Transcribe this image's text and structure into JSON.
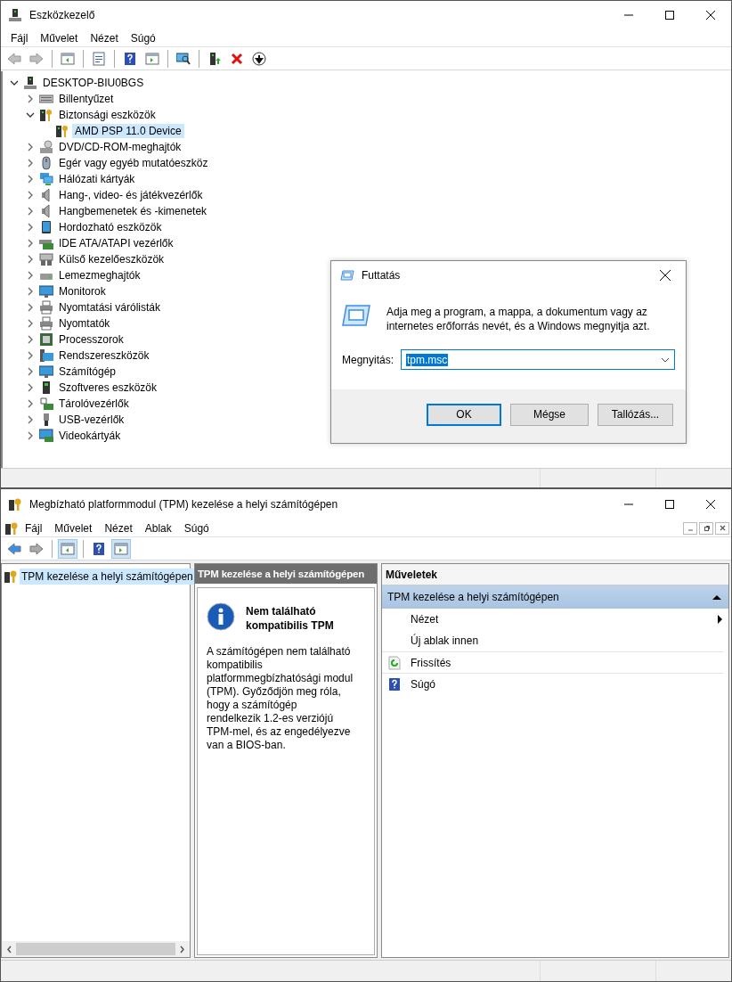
{
  "device_manager": {
    "title": "Eszközkezelő",
    "menu": [
      "Fájl",
      "Művelet",
      "Nézet",
      "Súgó"
    ],
    "toolbar": [
      {
        "kind": "back",
        "disabled": true
      },
      {
        "kind": "forward",
        "disabled": true
      },
      {
        "kind": "sep"
      },
      {
        "kind": "tree"
      },
      {
        "kind": "sep"
      },
      {
        "kind": "props"
      },
      {
        "kind": "sep"
      },
      {
        "kind": "help"
      },
      {
        "kind": "action"
      },
      {
        "kind": "sep"
      },
      {
        "kind": "scan"
      },
      {
        "kind": "sep"
      },
      {
        "kind": "update"
      },
      {
        "kind": "remove"
      },
      {
        "kind": "disable"
      }
    ],
    "tree": {
      "label": "DESKTOP-BIU0BGS",
      "kind": "computer-root",
      "expanded": true,
      "selected": false,
      "children": [
        {
          "label": "Billentyűzet",
          "kind": "keyboard",
          "expanded": false,
          "selected": false
        },
        {
          "label": "Biztonsági eszközök",
          "kind": "security",
          "expanded": true,
          "selected": false,
          "children": [
            {
              "label": "AMD PSP 11.0 Device",
              "kind": "security",
              "selected": true
            }
          ]
        },
        {
          "label": "DVD/CD-ROM-meghajtók",
          "kind": "dvd",
          "expanded": false,
          "selected": false
        },
        {
          "label": "Egér vagy egyéb mutatóeszköz",
          "kind": "mouse",
          "expanded": false,
          "selected": false
        },
        {
          "label": "Hálózati kártyák",
          "kind": "network",
          "expanded": false,
          "selected": false
        },
        {
          "label": "Hang-, video- és játékvezérlők",
          "kind": "sound",
          "expanded": false,
          "selected": false
        },
        {
          "label": "Hangbemenetek és -kimenetek",
          "kind": "sound",
          "expanded": false,
          "selected": false
        },
        {
          "label": "Hordozható eszközök",
          "kind": "portable",
          "expanded": false,
          "selected": false
        },
        {
          "label": "IDE ATA/ATAPI vezérlők",
          "kind": "controller",
          "expanded": false,
          "selected": false
        },
        {
          "label": "Külső kezelőeszközök",
          "kind": "hid",
          "expanded": false,
          "selected": false
        },
        {
          "label": "Lemezmeghajtók",
          "kind": "disk",
          "expanded": false,
          "selected": false
        },
        {
          "label": "Monitorok",
          "kind": "monitor",
          "expanded": false,
          "selected": false
        },
        {
          "label": "Nyomtatási várólisták",
          "kind": "printer",
          "expanded": false,
          "selected": false
        },
        {
          "label": "Nyomtatók",
          "kind": "printer",
          "expanded": false,
          "selected": false
        },
        {
          "label": "Processzorok",
          "kind": "cpu",
          "expanded": false,
          "selected": false
        },
        {
          "label": "Rendszereszközök",
          "kind": "system",
          "expanded": false,
          "selected": false
        },
        {
          "label": "Számítógép",
          "kind": "monitor",
          "expanded": false,
          "selected": false
        },
        {
          "label": "Szoftveres eszközök",
          "kind": "software",
          "expanded": false,
          "selected": false
        },
        {
          "label": "Tárolóvezérlők",
          "kind": "storage",
          "expanded": false,
          "selected": false
        },
        {
          "label": "USB-vezérlők",
          "kind": "usb",
          "expanded": false,
          "selected": false
        },
        {
          "label": "Videokártyák",
          "kind": "display",
          "expanded": false,
          "selected": false
        }
      ]
    }
  },
  "run_dialog": {
    "title": "Futtatás",
    "message": "Adja meg a program, a mappa, a dokumentum vagy az internetes erőforrás nevét, és a Windows megnyitja azt.",
    "field_label": "Megnyitás:",
    "value": "tpm.msc",
    "buttons": [
      {
        "label": "OK",
        "default": true
      },
      {
        "label": "Mégse",
        "default": false
      },
      {
        "label": "Tallózás...",
        "default": false
      }
    ]
  },
  "tpm_console": {
    "title": "Megbízható platformmodul (TPM) kezelése a helyi számítógépen",
    "menu": [
      "Fájl",
      "Művelet",
      "Nézet",
      "Ablak",
      "Súgó"
    ],
    "toolbar": [
      {
        "kind": "back",
        "pressed": false
      },
      {
        "kind": "forward",
        "pressed": false
      },
      {
        "kind": "sep"
      },
      {
        "kind": "tree",
        "pressed": true
      },
      {
        "kind": "sep"
      },
      {
        "kind": "help",
        "pressed": false
      },
      {
        "kind": "action",
        "pressed": true
      }
    ],
    "tree": [
      {
        "label": "TPM kezelése a helyi számítógépen",
        "selected": true
      }
    ],
    "center": {
      "header": "TPM kezelése a helyi számítógépen",
      "heading": "Nem található kompatibilis TPM",
      "text": "A számítógépen nem található kompatibilis platformmegbízhatósági modul (TPM). Győződjön meg róla, hogy a számítógép rendelkezik 1.2-es verziójú TPM-mel, és az engedélyezve van a BIOS-ban."
    },
    "actions": {
      "header": "Műveletek",
      "group": "TPM kezelése a helyi számítógépen",
      "expanded": true,
      "items": [
        {
          "label": "Nézet",
          "kind": "submenu"
        },
        {
          "label": "Új ablak innen",
          "kind": "plain"
        },
        {
          "label": "Frissítés",
          "kind": "refresh"
        },
        {
          "label": "Súgó",
          "kind": "help"
        }
      ]
    }
  }
}
